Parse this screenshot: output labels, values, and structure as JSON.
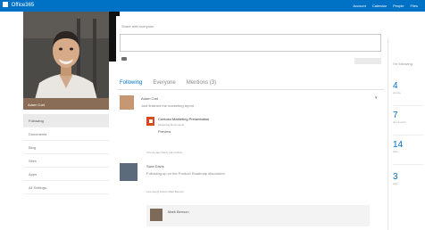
{
  "topbar": {
    "brand": "Office365",
    "nav": [
      "Account",
      "Calendar",
      "People",
      "Files"
    ]
  },
  "profile": {
    "name": "Adam Cart"
  },
  "left_menu": [
    "Following",
    "Documents",
    "Blog",
    "Sites",
    "Apps",
    "All Settings"
  ],
  "share": {
    "label": "Share with everyone",
    "placeholder": ""
  },
  "tabs": [
    "Following",
    "Everyone",
    "Mentions (3)"
  ],
  "posts": [
    {
      "author": "Adam Cart",
      "text": "Just finished the marketing report"
    },
    {
      "author": "Sara Davis",
      "text": "Following up on the Product Roadmap discussion",
      "reply_author": "Mark Benson"
    }
  ],
  "attachment": {
    "title": "Contoso Marketing Presentation",
    "subtitle": "Marketing Documents",
    "action": "Preview"
  },
  "post_meta": {
    "first": "3 hours ago  Reply  Like  Follow",
    "second": "Like  Reply  Follow  Mark Benson"
  },
  "right_rail": {
    "heading": "I'm following",
    "stats": [
      {
        "num": "4",
        "label": "people"
      },
      {
        "num": "7",
        "label": "documents"
      },
      {
        "num": "14",
        "label": "sites"
      },
      {
        "num": "3",
        "label": "tags"
      }
    ]
  }
}
